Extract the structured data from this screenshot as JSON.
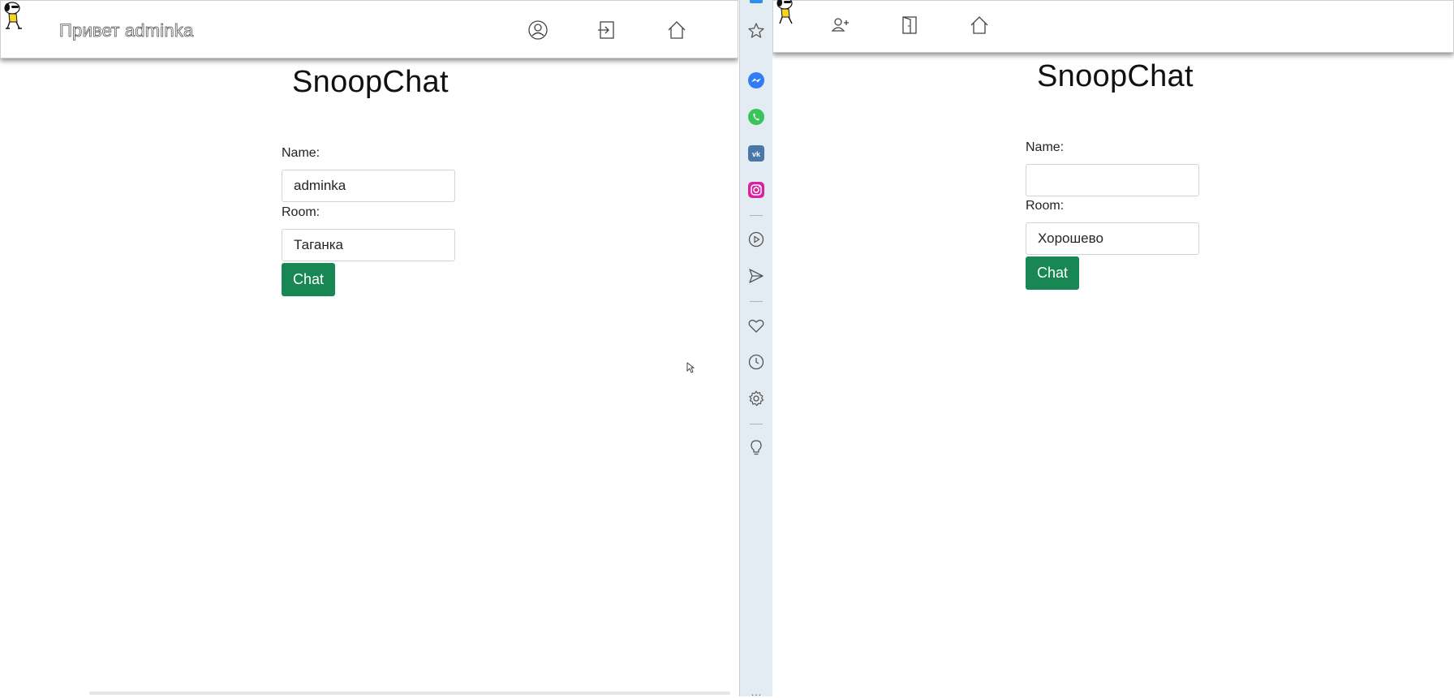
{
  "left_window": {
    "greeting": "Привет adminka",
    "nav": {
      "icons": [
        "user-circle-icon",
        "logout-icon",
        "home-icon"
      ]
    },
    "brand": "SnoopChat",
    "form": {
      "name_label": "Name:",
      "name_value": "adminka",
      "room_label": "Room:",
      "room_value": "Таганка",
      "submit_label": "Chat"
    }
  },
  "right_window": {
    "nav": {
      "icons": [
        "user-plus-icon",
        "door-icon",
        "home-icon"
      ]
    },
    "brand": "SnoopChat",
    "form": {
      "name_label": "Name:",
      "name_value": "",
      "room_label": "Room:",
      "room_value": "Хорошево",
      "submit_label": "Chat"
    }
  },
  "sidebar": {
    "items": [
      "star-icon",
      "messenger-icon",
      "whatsapp-icon",
      "vk-icon",
      "instagram-icon",
      "player-icon",
      "send-icon",
      "heart-icon",
      "history-icon",
      "settings-icon",
      "bulb-icon"
    ],
    "more": "..."
  },
  "colors": {
    "accent_button": "#198754",
    "sidebar_bg": "#e4ecf3",
    "messenger": "#2f7cf6",
    "whatsapp": "#3cc45c",
    "vk": "#4a76a8",
    "instagram": "#d6249f"
  }
}
